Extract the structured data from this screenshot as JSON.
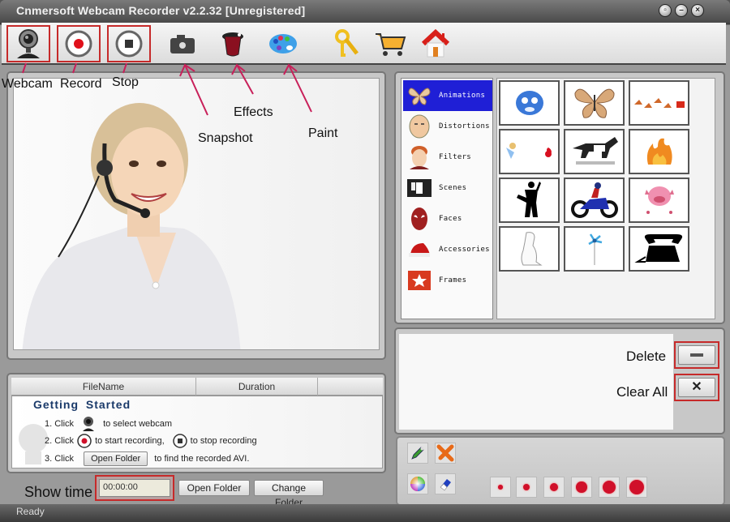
{
  "window": {
    "title": "Cnmersoft Webcam Recorder v2.2.32 [Unregistered]",
    "controls": [
      "restore-icon",
      "minimize-icon",
      "close-icon"
    ]
  },
  "toolbar": {
    "items": [
      {
        "name": "webcam",
        "icon": "webcam-icon",
        "highlighted": true
      },
      {
        "name": "record",
        "icon": "record-icon",
        "highlighted": true
      },
      {
        "name": "stop",
        "icon": "stop-icon",
        "highlighted": true
      },
      {
        "name": "snapshot",
        "icon": "camera-icon",
        "highlighted": false
      },
      {
        "name": "effects",
        "icon": "magic-hat-icon",
        "highlighted": false
      },
      {
        "name": "paint",
        "icon": "palette-icon",
        "highlighted": false
      },
      {
        "name": "register",
        "icon": "keys-icon",
        "highlighted": false
      },
      {
        "name": "buy",
        "icon": "cart-icon",
        "highlighted": false
      },
      {
        "name": "home",
        "icon": "home-icon",
        "highlighted": false
      }
    ]
  },
  "annotations": {
    "webcam": "Webcam",
    "record": "Record",
    "stop": "Stop",
    "snapshot": "Snapshot",
    "effects": "Effects",
    "paint": "Paint",
    "delete": "Delete",
    "clear_all": "Clear All",
    "show_time": "Show time"
  },
  "effects": {
    "categories": [
      {
        "label": "Animations",
        "icon": "butterfly-icon",
        "selected": true
      },
      {
        "label": "Distortions",
        "icon": "face-distort-icon",
        "selected": false
      },
      {
        "label": "Filters",
        "icon": "face-filter-icon",
        "selected": false
      },
      {
        "label": "Scenes",
        "icon": "scene-icon",
        "selected": false
      },
      {
        "label": "Faces",
        "icon": "mask-icon",
        "selected": false
      },
      {
        "label": "Accessories",
        "icon": "hat-icon",
        "selected": false
      },
      {
        "label": "Frames",
        "icon": "frame-icon",
        "selected": false
      }
    ],
    "thumbnails": [
      "blue-smiley",
      "butterfly",
      "walking-chicks",
      "cupid-heart",
      "running-dog",
      "fire",
      "dancer-silhouette",
      "motorcycle-rider",
      "pink-pig",
      "outline-figure",
      "pinwheel",
      "telephone"
    ]
  },
  "file_list": {
    "columns": [
      "FileName",
      "Duration",
      ""
    ],
    "getting_started": {
      "title": "Getting Started",
      "step1_prefix": "1. Click",
      "step1_suffix": "to select webcam",
      "step2_prefix": "2. Click",
      "step2_middle": "to start recording,",
      "step2_suffix": "to stop recording",
      "step3_prefix": "3. Click",
      "step3_button": "Open Folder",
      "step3_suffix": "to find the recorded AVI."
    }
  },
  "bottom": {
    "time_value": "00:00:00",
    "open_folder": "Open Folder",
    "change_folder": "Change Folder"
  },
  "paint": {
    "tools": [
      "pencil-icon",
      "clear-paint-icon",
      "color-wheel-icon",
      "eraser-icon"
    ],
    "brush_sizes": [
      1,
      2,
      3,
      4,
      5,
      6
    ],
    "brush_color": "#d0102a"
  },
  "status": {
    "text": "Ready"
  }
}
